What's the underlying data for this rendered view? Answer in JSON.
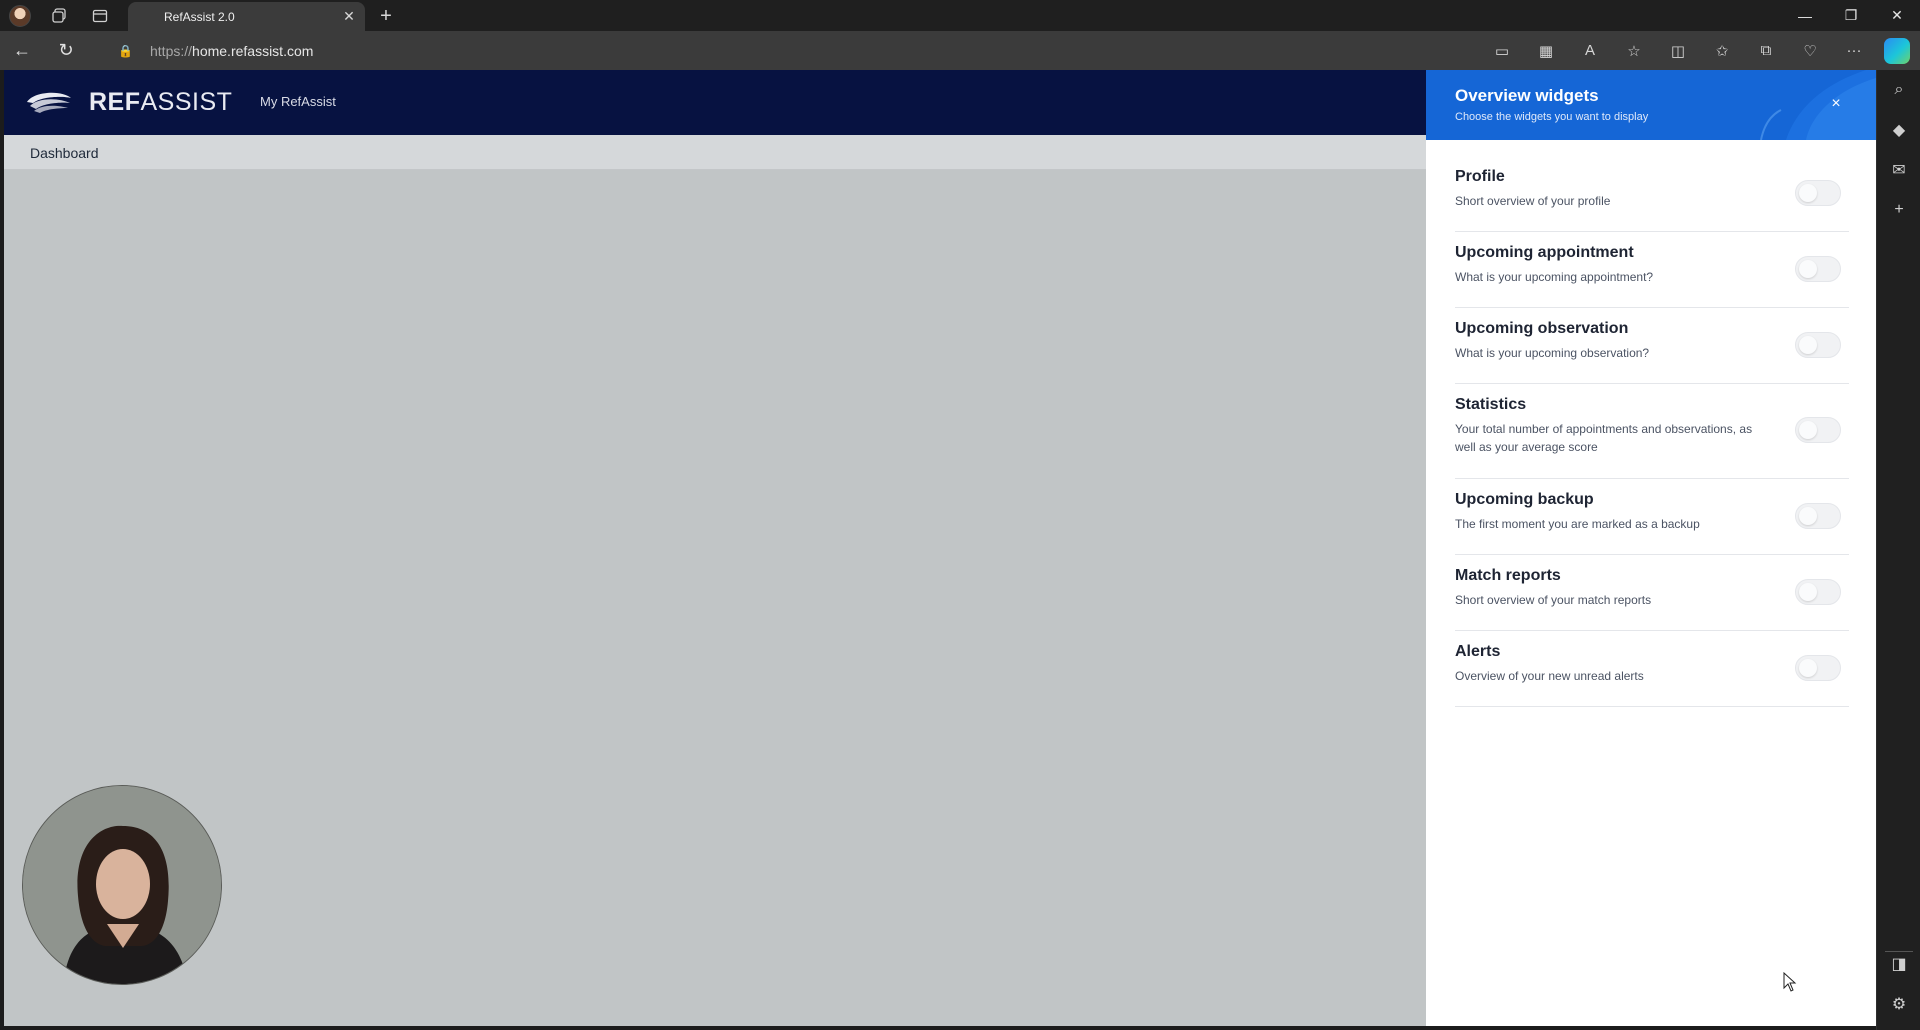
{
  "browser": {
    "tab_title": "RefAssist 2.0",
    "url_protocol": "https://",
    "url_host": "home.refassist.com"
  },
  "app": {
    "logo_bold": "REF",
    "logo_light": "ASSIST",
    "nav_item": "My RefAssist",
    "subnav_item": "Dashboard"
  },
  "panel": {
    "title": "Overview widgets",
    "subtitle": "Choose the widgets you want to display",
    "close_glyph": "×",
    "widgets": [
      {
        "title": "Profile",
        "desc": "Short overview of your profile",
        "enabled": false
      },
      {
        "title": "Upcoming appointment",
        "desc": "What is your upcoming appointment?",
        "enabled": false
      },
      {
        "title": "Upcoming observation",
        "desc": "What is your upcoming observation?",
        "enabled": false
      },
      {
        "title": "Statistics",
        "desc": "Your total number of appointments and observations, as well as your average score",
        "enabled": false
      },
      {
        "title": "Upcoming backup",
        "desc": "The first moment you are marked as a backup",
        "enabled": false
      },
      {
        "title": "Match reports",
        "desc": "Short overview of your match reports",
        "enabled": false
      },
      {
        "title": "Alerts",
        "desc": "Overview of your new unread alerts",
        "enabled": false
      }
    ]
  },
  "colors": {
    "header_navy": "#071241",
    "panel_blue": "#1566d6",
    "page_bg": "#c1c5c6"
  }
}
